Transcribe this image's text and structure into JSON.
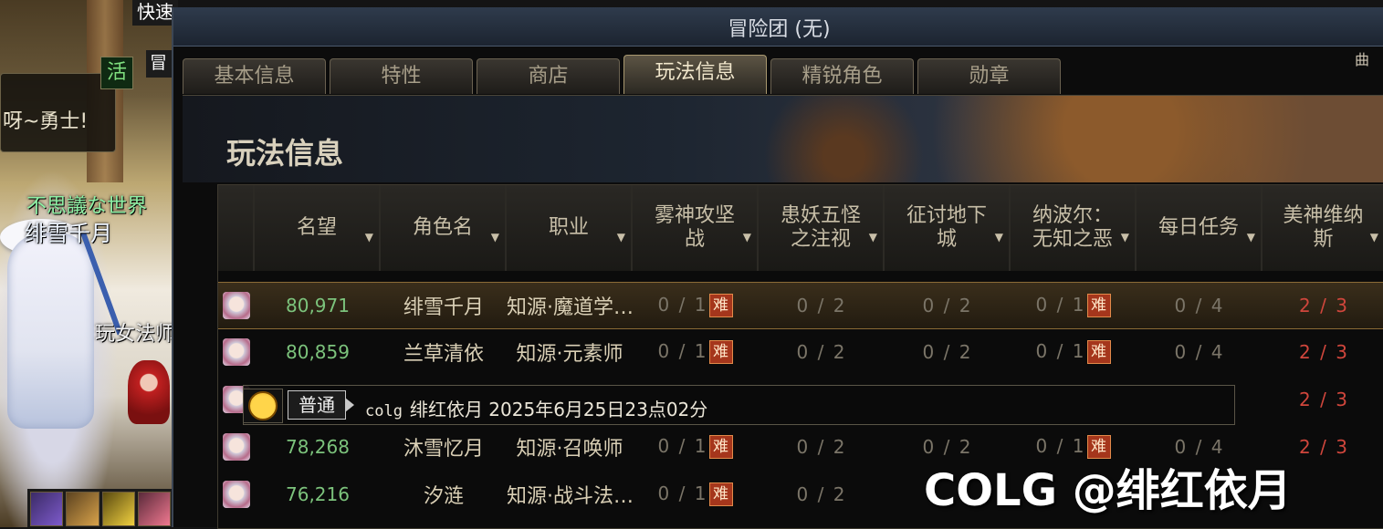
{
  "scene": {
    "kuai": "快速",
    "mao": "冒",
    "chat_text": "呀~勇士!",
    "live_badge": "活",
    "guild": "不思議な世界",
    "nickname": "绯雪千月",
    "play_name": "玩女法师",
    "right_edge": "曲"
  },
  "window": {
    "title": "冒险团 (无)",
    "section_title": "玩法信息",
    "tabs": [
      "基本信息",
      "特性",
      "商店",
      "玩法信息",
      "精锐角色",
      "勋章"
    ],
    "active_tab": "玩法信息"
  },
  "table": {
    "headers": [
      "名望",
      "角色名",
      "职业",
      "雾神攻坚战",
      "患妖五怪之注视",
      "征讨地下城",
      "纳波尔：无知之恶",
      "每日任务",
      "美神维纳斯"
    ],
    "hard_label": "难",
    "rows": [
      {
        "fame": "80,971",
        "name": "绯雪千月",
        "job": "知源·魔道学…",
        "c1": "0 / 1",
        "c2": "0 / 2",
        "c3": "0 / 2",
        "c4": "0 / 1",
        "c5": "0 / 4",
        "c6": "2 / 3"
      },
      {
        "fame": "80,859",
        "name": "兰草清依",
        "job": "知源·元素师",
        "c1": "0 / 1",
        "c2": "0 / 2",
        "c3": "0 / 2",
        "c4": "0 / 1",
        "c5": "0 / 4",
        "c6": "2 / 3"
      },
      {
        "fame": "",
        "name": "",
        "job": "",
        "c1": "",
        "c2": "",
        "c3": "",
        "c4": "",
        "c5": "",
        "c6": "2 / 3"
      },
      {
        "fame": "78,268",
        "name": "沐雪忆月",
        "job": "知源·召唤师",
        "c1": "0 / 1",
        "c2": "0 / 2",
        "c3": "0 / 2",
        "c4": "0 / 1",
        "c5": "0 / 4",
        "c6": "2 / 3"
      },
      {
        "fame": "76,216",
        "name": "汐涟",
        "job": "知源·战斗法…",
        "c1": "0 / 1",
        "c2": "0 / 2",
        "c3": "",
        "c4": "",
        "c5": "",
        "c6": ""
      }
    ]
  },
  "chat": {
    "badge": "普通",
    "tag": "colg",
    "text": "绯红依月 2025年6月25日23点02分"
  },
  "watermark": "COLG @绯红依月"
}
